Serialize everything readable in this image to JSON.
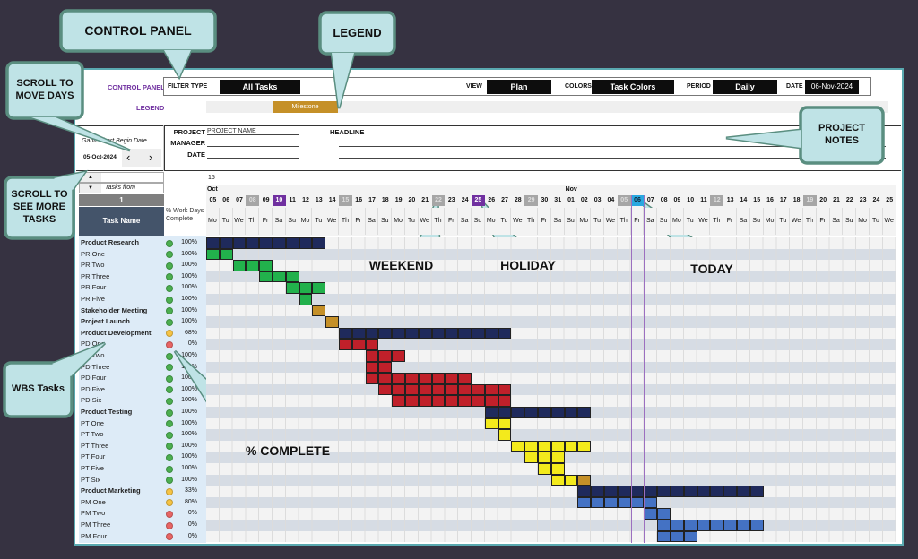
{
  "control_panel": {
    "title": "CONTROL PANEL",
    "filter_type_label": "FILTER TYPE",
    "filter_type": "All Tasks",
    "view_label": "VIEW",
    "view": "Plan",
    "colors_label": "COLORS",
    "colors": "Task Colors",
    "period_label": "PERIOD",
    "period": "Daily",
    "date_label": "DATE",
    "date": "06-Nov-2024"
  },
  "legend": {
    "title": "LEGEND",
    "items": [
      {
        "label": "Milestone",
        "color": "#c59028"
      }
    ]
  },
  "project": {
    "project_label": "PROJECT",
    "project_value": "PROJECT NAME",
    "manager_label": "MANAGER",
    "date_label": "DATE",
    "headline_label": "HEADLINE"
  },
  "gantt_begin": {
    "label": "Gantt Chart Begin Date",
    "date": "05-Oct-2024",
    "prev_icon": "chevron-left-icon",
    "next_icon": "chevron-right-icon"
  },
  "task_scroll": {
    "tasks_from_label": "Tasks from",
    "value": "1",
    "up_icon": "triangle-up-icon",
    "down_icon": "triangle-down-icon"
  },
  "table_header": {
    "task_name": "Task Name",
    "pct": "% Work Days Complete"
  },
  "timeline": {
    "week_label": "15",
    "months": [
      {
        "name": "Oct",
        "start": "05-Oct"
      },
      {
        "name": "Nov",
        "start": "01-Nov"
      }
    ],
    "today": "06-Nov",
    "weekend_marks": [
      "08-Oct",
      "15-Oct",
      "22-Oct",
      "29-Oct",
      "05-Nov",
      "12-Nov",
      "19-Nov"
    ],
    "holidays": [
      "10-Oct",
      "25-Oct"
    ],
    "dow": [
      "Mo",
      "Tu",
      "We",
      "Th",
      "Fr",
      "Sa",
      "Su"
    ],
    "columns": [
      "05-Oct",
      "06-Oct",
      "07-Oct",
      "08-Oct",
      "09-Oct",
      "10-Oct",
      "11-Oct",
      "12-Oct",
      "13-Oct",
      "14-Oct",
      "15-Oct",
      "16-Oct",
      "17-Oct",
      "18-Oct",
      "19-Oct",
      "20-Oct",
      "21-Oct",
      "22-Oct",
      "23-Oct",
      "24-Oct",
      "25-Oct",
      "26-Oct",
      "27-Oct",
      "28-Oct",
      "29-Oct",
      "30-Oct",
      "31-Oct",
      "01-Nov",
      "02-Nov",
      "03-Nov",
      "04-Nov",
      "05-Nov",
      "06-Nov",
      "07-Nov",
      "08-Nov",
      "09-Nov",
      "10-Nov",
      "11-Nov",
      "12-Nov",
      "13-Nov",
      "14-Nov",
      "15-Nov",
      "16-Nov",
      "17-Nov",
      "18-Nov",
      "19-Nov",
      "20-Nov",
      "21-Nov",
      "22-Nov",
      "23-Nov",
      "24-Nov",
      "25-Nov"
    ]
  },
  "colors": {
    "navy": "#1f2a5c",
    "green": "#22b14c",
    "gold": "#c59028",
    "red": "#c0202a",
    "yellow": "#f3ea1c",
    "blue": "#4472c4",
    "status_green": "#4caf50",
    "status_yellow": "#f6c343",
    "status_red": "#e86464",
    "weekend": "#a6a6a6",
    "holiday": "#7030a0",
    "today": "#29a8e0"
  },
  "tasks": [
    {
      "name": "Product Research",
      "bold": true,
      "pct": "100%",
      "status": "green",
      "bars": [
        {
          "start": "05-Oct",
          "end": "13-Oct",
          "color": "navy"
        }
      ]
    },
    {
      "name": "PR One",
      "pct": "100%",
      "status": "green",
      "bars": [
        {
          "start": "05-Oct",
          "end": "06-Oct",
          "color": "green"
        }
      ]
    },
    {
      "name": "PR Two",
      "pct": "100%",
      "status": "green",
      "bars": [
        {
          "start": "07-Oct",
          "end": "09-Oct",
          "color": "green"
        }
      ]
    },
    {
      "name": "PR Three",
      "pct": "100%",
      "status": "green",
      "bars": [
        {
          "start": "09-Oct",
          "end": "11-Oct",
          "color": "green"
        }
      ]
    },
    {
      "name": "PR Four",
      "pct": "100%",
      "status": "green",
      "bars": [
        {
          "start": "11-Oct",
          "end": "13-Oct",
          "color": "green"
        }
      ]
    },
    {
      "name": "PR Five",
      "pct": "100%",
      "status": "green",
      "bars": [
        {
          "start": "12-Oct",
          "end": "12-Oct",
          "color": "green"
        }
      ]
    },
    {
      "name": "Stakeholder Meeting",
      "bold": true,
      "pct": "100%",
      "status": "green",
      "bars": [
        {
          "start": "13-Oct",
          "end": "13-Oct",
          "color": "gold"
        }
      ]
    },
    {
      "name": "Project Launch",
      "bold": true,
      "pct": "100%",
      "status": "green",
      "bars": [
        {
          "start": "14-Oct",
          "end": "14-Oct",
          "color": "gold"
        }
      ]
    },
    {
      "name": "Product Development",
      "bold": true,
      "pct": "68%",
      "status": "yellow",
      "bars": [
        {
          "start": "15-Oct",
          "end": "27-Oct",
          "color": "navy"
        }
      ]
    },
    {
      "name": "PD One",
      "pct": "0%",
      "status": "red",
      "bars": [
        {
          "start": "15-Oct",
          "end": "17-Oct",
          "color": "red"
        }
      ]
    },
    {
      "name": "PD Two",
      "pct": "100%",
      "status": "green",
      "bars": [
        {
          "start": "17-Oct",
          "end": "19-Oct",
          "color": "red"
        }
      ]
    },
    {
      "name": "PD Three",
      "pct": "100%",
      "status": "green",
      "bars": [
        {
          "start": "17-Oct",
          "end": "18-Oct",
          "color": "red"
        }
      ]
    },
    {
      "name": "PD Four",
      "pct": "100%",
      "status": "green",
      "bars": [
        {
          "start": "17-Oct",
          "end": "24-Oct",
          "color": "red"
        }
      ]
    },
    {
      "name": "PD Five",
      "pct": "100%",
      "status": "green",
      "bars": [
        {
          "start": "18-Oct",
          "end": "27-Oct",
          "color": "red"
        }
      ]
    },
    {
      "name": "PD Six",
      "pct": "100%",
      "status": "green",
      "bars": [
        {
          "start": "19-Oct",
          "end": "27-Oct",
          "color": "red"
        }
      ]
    },
    {
      "name": "Product Testing",
      "bold": true,
      "pct": "100%",
      "status": "green",
      "bars": [
        {
          "start": "26-Oct",
          "end": "02-Nov",
          "color": "navy"
        }
      ]
    },
    {
      "name": "PT One",
      "pct": "100%",
      "status": "green",
      "bars": [
        {
          "start": "26-Oct",
          "end": "27-Oct",
          "color": "yellow"
        }
      ]
    },
    {
      "name": "PT Two",
      "pct": "100%",
      "status": "green",
      "bars": [
        {
          "start": "27-Oct",
          "end": "27-Oct",
          "color": "yellow"
        }
      ]
    },
    {
      "name": "PT Three",
      "pct": "100%",
      "status": "green",
      "bars": [
        {
          "start": "28-Oct",
          "end": "02-Nov",
          "color": "yellow"
        }
      ]
    },
    {
      "name": "PT Four",
      "pct": "100%",
      "status": "green",
      "bars": [
        {
          "start": "29-Oct",
          "end": "31-Oct",
          "color": "yellow"
        }
      ]
    },
    {
      "name": "PT Five",
      "pct": "100%",
      "status": "green",
      "bars": [
        {
          "start": "30-Oct",
          "end": "31-Oct",
          "color": "yellow"
        }
      ]
    },
    {
      "name": "PT Six",
      "pct": "100%",
      "status": "green",
      "bars": [
        {
          "start": "31-Oct",
          "end": "01-Nov",
          "color": "yellow"
        },
        {
          "start": "02-Nov",
          "end": "02-Nov",
          "color": "gold"
        }
      ]
    },
    {
      "name": "Product Marketing",
      "bold": true,
      "pct": "33%",
      "status": "yellow",
      "bars": [
        {
          "start": "02-Nov",
          "end": "15-Nov",
          "color": "navy"
        }
      ]
    },
    {
      "name": "PM One",
      "pct": "80%",
      "status": "yellow",
      "bars": [
        {
          "start": "02-Nov",
          "end": "07-Nov",
          "color": "blue"
        }
      ]
    },
    {
      "name": "PM Two",
      "pct": "0%",
      "status": "red",
      "bars": [
        {
          "start": "07-Nov",
          "end": "08-Nov",
          "color": "blue"
        }
      ]
    },
    {
      "name": "PM Three",
      "pct": "0%",
      "status": "red",
      "bars": [
        {
          "start": "08-Nov",
          "end": "15-Nov",
          "color": "blue"
        }
      ]
    },
    {
      "name": "PM Four",
      "pct": "0%",
      "status": "red",
      "bars": [
        {
          "start": "08-Nov",
          "end": "10-Nov",
          "color": "blue"
        }
      ]
    }
  ],
  "callouts": {
    "control_panel": "CONTROL PANEL",
    "legend": "LEGEND",
    "scroll_days": "SCROLL TO MOVE DAYS",
    "project_notes": "PROJECT NOTES",
    "scroll_tasks": "SCROLL TO SEE MORE TASKS",
    "weekend": "WEEKEND",
    "holiday": "HOLIDAY",
    "today": "TODAY",
    "wbs": "WBS Tasks",
    "pct_complete": "% COMPLETE"
  }
}
